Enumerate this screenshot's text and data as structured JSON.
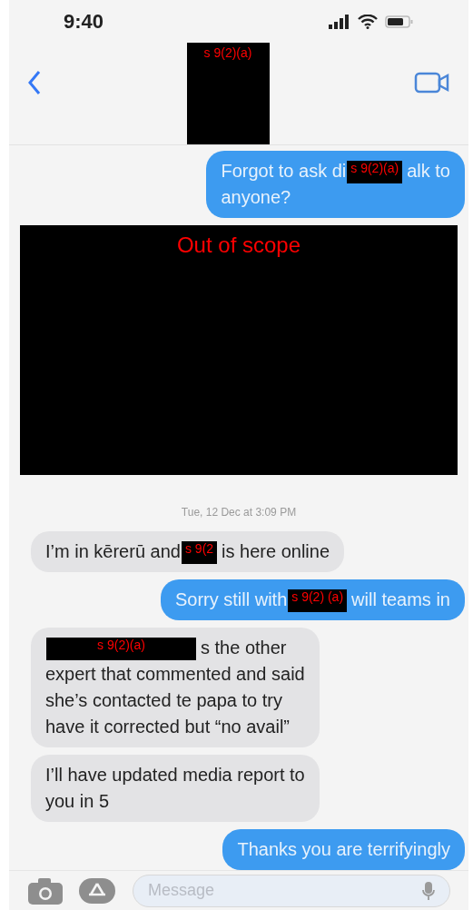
{
  "status_bar": {
    "time": "9:40"
  },
  "header": {
    "contact_redaction": "s 9(2)(a)"
  },
  "messages": [
    {
      "kind": "outgoing",
      "segments": [
        {
          "kind": "text",
          "text": "Forgot to ask di"
        },
        {
          "kind": "redaction",
          "label": "s 9(2)(a)"
        },
        {
          "kind": "text",
          "text": "alk to"
        },
        {
          "kind": "break"
        },
        {
          "kind": "text",
          "text": "anyone?"
        }
      ]
    },
    {
      "kind": "redaction_block",
      "label": "Out of scope"
    },
    {
      "kind": "timestamp",
      "text": "Tue, 12 Dec at 3:09 PM"
    },
    {
      "kind": "incoming",
      "segments": [
        {
          "kind": "text",
          "text": "I’m in kērerū and"
        },
        {
          "kind": "redaction",
          "label": "s 9(2"
        },
        {
          "kind": "text",
          "text": "is here online"
        }
      ]
    },
    {
      "kind": "outgoing",
      "segments": [
        {
          "kind": "text",
          "text": "Sorry still with"
        },
        {
          "kind": "redaction",
          "label": "s 9(2) (a)"
        },
        {
          "kind": "text",
          "text": "will teams in"
        }
      ]
    },
    {
      "kind": "incoming",
      "segments": [
        {
          "kind": "redaction",
          "label": "s 9(2)(a)"
        },
        {
          "kind": "text",
          "text": "s the other"
        },
        {
          "kind": "break"
        },
        {
          "kind": "text",
          "text": "expert that commented and said"
        },
        {
          "kind": "break"
        },
        {
          "kind": "text",
          "text": "she’s contacted te papa to try"
        },
        {
          "kind": "break"
        },
        {
          "kind": "text",
          "text": "have it corrected but “no avail”"
        }
      ]
    },
    {
      "kind": "incoming",
      "segments": [
        {
          "kind": "text",
          "text": "I’ll have updated media report to"
        },
        {
          "kind": "break"
        },
        {
          "kind": "text",
          "text": "you in 5"
        }
      ]
    },
    {
      "kind": "outgoing",
      "segments": [
        {
          "kind": "text",
          "text": "Thanks you are terrifyingly"
        }
      ]
    }
  ],
  "composer": {
    "placeholder": "Message"
  }
}
